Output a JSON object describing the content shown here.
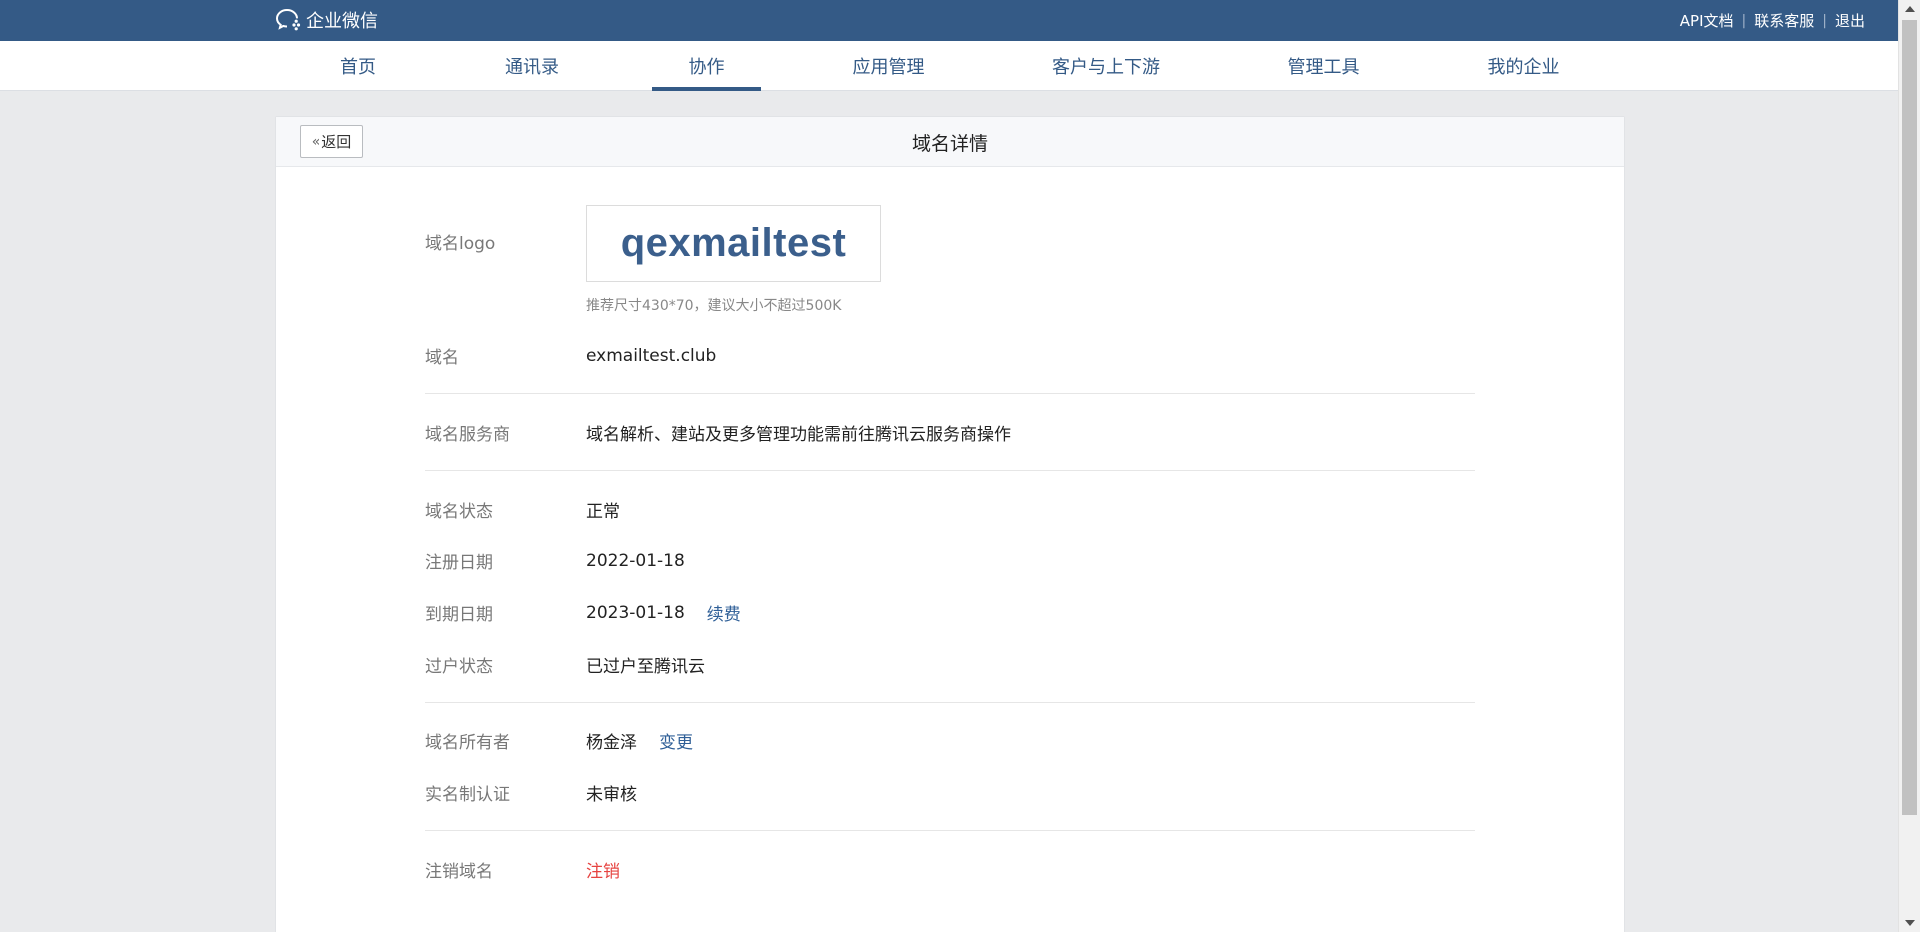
{
  "topbar": {
    "brand": "企业微信",
    "links": [
      "API文档",
      "联系客服",
      "退出"
    ]
  },
  "nav": {
    "items": [
      "首页",
      "通讯录",
      "协作",
      "应用管理",
      "客户与上下游",
      "管理工具",
      "我的企业"
    ],
    "active_index": 2
  },
  "card": {
    "back_label": "返回",
    "title": "域名详情"
  },
  "details": {
    "logo": {
      "label": "域名logo",
      "logo_text": "qexmailtest",
      "hint": "推荐尺寸430*70，建议大小不超过500K"
    },
    "domain": {
      "label": "域名",
      "value": "exmailtest.club"
    },
    "provider": {
      "label": "域名服务商",
      "value": "域名解析、建站及更多管理功能需前往腾讯云服务商操作"
    },
    "status": {
      "label": "域名状态",
      "value": "正常"
    },
    "registered": {
      "label": "注册日期",
      "value": "2022-01-18"
    },
    "expires": {
      "label": "到期日期",
      "value": "2023-01-18",
      "action": "续费"
    },
    "transfer": {
      "label": "过户状态",
      "value": "已过户至腾讯云"
    },
    "owner": {
      "label": "域名所有者",
      "value": "杨金泽",
      "action": "变更"
    },
    "verification": {
      "label": "实名制认证",
      "value": "未审核"
    },
    "cancel": {
      "label": "注销域名",
      "action": "注销"
    }
  },
  "colors": {
    "topbar": "#345a86",
    "accent": "#345a86",
    "link": "#2f5f97",
    "danger": "#e64340",
    "background": "#e9eaec"
  }
}
